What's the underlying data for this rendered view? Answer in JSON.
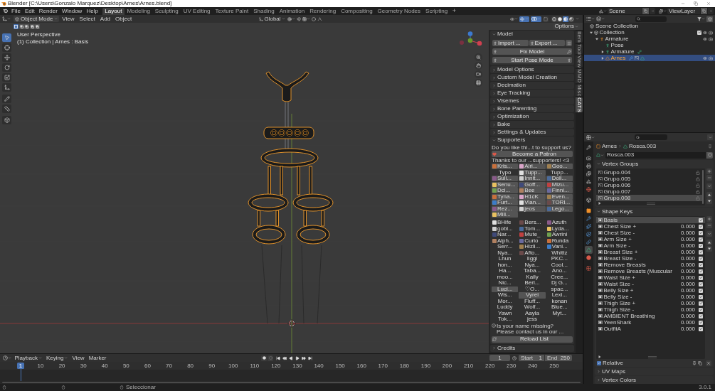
{
  "window": {
    "title": "Blender [C:\\Users\\Gonzalo Marquez\\Desktop\\Arnes\\Arnes.blend]"
  },
  "menu": [
    "File",
    "Edit",
    "Render",
    "Window",
    "Help"
  ],
  "workspaces": [
    {
      "label": "Layout",
      "selected": true
    },
    {
      "label": "Modeling",
      "selected": false
    },
    {
      "label": "Sculpting",
      "selected": false
    },
    {
      "label": "UV Editing",
      "selected": false
    },
    {
      "label": "Texture Paint",
      "selected": false
    },
    {
      "label": "Shading",
      "selected": false
    },
    {
      "label": "Animation",
      "selected": false
    },
    {
      "label": "Rendering",
      "selected": false
    },
    {
      "label": "Compositing",
      "selected": false
    },
    {
      "label": "Geometry Nodes",
      "selected": false
    },
    {
      "label": "Scripting",
      "selected": false
    }
  ],
  "add_workspace": "+",
  "scene_selector": {
    "scene": "Scene",
    "view_layer": "ViewLayer"
  },
  "viewport": {
    "mode": "Object Mode",
    "menus": [
      "View",
      "Select",
      "Add",
      "Object"
    ],
    "orientation": "Global",
    "toggles": [
      {
        "kind": "gizmos",
        "on": true
      },
      {
        "kind": "overlays",
        "on": true
      },
      {
        "kind": "xray",
        "on": false
      }
    ],
    "shading": [
      {
        "kind": "wireframe",
        "selected": false
      },
      {
        "kind": "solid",
        "selected": false
      },
      {
        "kind": "material",
        "selected": true
      },
      {
        "kind": "rendered",
        "selected": false
      }
    ],
    "select_modes": [
      {
        "selected": true
      },
      {
        "selected": false
      },
      {
        "selected": false
      },
      {
        "selected": false
      },
      {
        "selected": false
      }
    ],
    "options": "Options",
    "view_info": [
      "User Perspective",
      "(1) Collection | Arnes : Basis"
    ],
    "tools": [
      {
        "kind": "select",
        "selected": true
      },
      {
        "kind": "cursor",
        "selected": false
      },
      {
        "kind": "move",
        "selected": false
      },
      {
        "kind": "rotate",
        "selected": false
      },
      {
        "kind": "scale",
        "selected": false
      },
      {
        "kind": "transform",
        "selected": false
      },
      {
        "kind": "annotate",
        "selected": false
      },
      {
        "kind": "measure",
        "selected": false
      },
      {
        "kind": "add-cube",
        "selected": false
      }
    ]
  },
  "sidebar_tabs": [
    {
      "label": "Item",
      "selected": false
    },
    {
      "label": "Tool",
      "selected": false
    },
    {
      "label": "View",
      "selected": false
    },
    {
      "label": "MMD",
      "selected": false
    },
    {
      "label": "Misc",
      "selected": false
    },
    {
      "label": "CATS",
      "selected": true
    }
  ],
  "cats": {
    "model": {
      "title": "Model",
      "expanded": true,
      "import": "Import ...",
      "export": "Export ...",
      "fix": "Fix Model",
      "pose": "Start Pose Mode"
    },
    "sections": [
      {
        "title": "Model Options",
        "expanded": false
      },
      {
        "title": "Custom Model Creation",
        "expanded": false
      },
      {
        "title": "Decimation",
        "expanded": false
      },
      {
        "title": "Eye Tracking",
        "expanded": false
      },
      {
        "title": "Visemes",
        "expanded": false
      },
      {
        "title": "Bone Parenting",
        "expanded": false
      },
      {
        "title": "Optimization",
        "expanded": false
      },
      {
        "title": "Bake",
        "expanded": false
      },
      {
        "title": "Settings & Updates",
        "expanded": false
      }
    ],
    "supporters": {
      "title": "Supporters",
      "expanded": true,
      "question": "Do you like thi...t to support us?",
      "patron": "Become a Patron",
      "thanks": "Thanks to our ...supporters! <3",
      "featured": [
        {
          "name": "Kris...",
          "kind": "tile",
          "avatar": true
        },
        {
          "name": "Airi...",
          "kind": "tile",
          "avatar": true
        },
        {
          "name": "Goo...",
          "kind": "tile",
          "avatar": true
        },
        {
          "name": "Typo",
          "kind": "plain",
          "avatar": false
        },
        {
          "name": "Tupp...",
          "kind": "tile",
          "avatar": true
        },
        {
          "name": "Tupp...",
          "kind": "plain",
          "avatar": false
        },
        {
          "name": "Suli...",
          "kind": "tile",
          "avatar": true
        },
        {
          "name": "Innit...",
          "kind": "tile",
          "avatar": true
        },
        {
          "name": "Doli...",
          "kind": "tile",
          "avatar": true
        },
        {
          "name": "Senu...",
          "kind": "tile",
          "avatar": true
        },
        {
          "name": "Goff...",
          "kind": "tile",
          "avatar": true
        },
        {
          "name": "Mizu...",
          "kind": "tile",
          "avatar": true
        },
        {
          "name": "Dci...",
          "kind": "tile",
          "avatar": true
        },
        {
          "name": "Bee",
          "kind": "tile",
          "avatar": true
        },
        {
          "name": "Finni...",
          "kind": "tile",
          "avatar": true
        },
        {
          "name": "Tyna...",
          "kind": "tile",
          "avatar": true
        },
        {
          "name": "H1cK",
          "kind": "tile",
          "avatar": true
        },
        {
          "name": "Even...",
          "kind": "tile",
          "avatar": true
        },
        {
          "name": "Furt...",
          "kind": "tile",
          "avatar": true
        },
        {
          "name": "Vian...",
          "kind": "tile",
          "avatar": true
        },
        {
          "name": "TORI...",
          "kind": "tile",
          "avatar": true
        },
        {
          "name": "Rez...",
          "kind": "tile",
          "avatar": true
        },
        {
          "name": "jeos",
          "kind": "tile",
          "avatar": true
        },
        {
          "name": "Lego...",
          "kind": "tile",
          "avatar": true
        },
        {
          "name": "Mili...",
          "kind": "tile",
          "avatar": true
        }
      ],
      "others": [
        {
          "name": "BHife",
          "kind": "plain",
          "avatar": true
        },
        {
          "name": "Bers...",
          "kind": "plain",
          "avatar": true
        },
        {
          "name": "Azuth",
          "kind": "plain",
          "avatar": true
        },
        {
          "name": "gobl...",
          "kind": "plain",
          "avatar": true
        },
        {
          "name": "Tom...",
          "kind": "plain",
          "avatar": true
        },
        {
          "name": "Lyda...",
          "kind": "plain",
          "avatar": true
        },
        {
          "name": "Nar...",
          "kind": "plain",
          "avatar": true
        },
        {
          "name": "Mute_",
          "kind": "plain",
          "avatar": true
        },
        {
          "name": "Awrini",
          "kind": "plain",
          "avatar": true
        },
        {
          "name": "Alph...",
          "kind": "plain",
          "avatar": true
        },
        {
          "name": "Curio",
          "kind": "plain",
          "avatar": true
        },
        {
          "name": "Runda",
          "kind": "plain",
          "avatar": true
        },
        {
          "name": "Serr...",
          "kind": "plain",
          "avatar": false
        },
        {
          "name": "Hizli...",
          "kind": "plain",
          "avatar": true
        },
        {
          "name": "Vani...",
          "kind": "plain",
          "avatar": true
        },
        {
          "name": "Nya...",
          "kind": "plain",
          "avatar": false
        },
        {
          "name": "Afto...",
          "kind": "plain",
          "avatar": true
        },
        {
          "name": "Whittz",
          "kind": "plain",
          "avatar": false
        },
        {
          "name": "Lhun",
          "kind": "plain",
          "avatar": false
        },
        {
          "name": "Iiggi",
          "kind": "plain",
          "avatar": false
        },
        {
          "name": "PKC...",
          "kind": "plain",
          "avatar": false
        },
        {
          "name": "hon...",
          "kind": "plain",
          "avatar": false
        },
        {
          "name": "Nya...",
          "kind": "plain",
          "avatar": false
        },
        {
          "name": "Cool...",
          "kind": "plain",
          "avatar": false
        },
        {
          "name": "Ha...",
          "kind": "plain",
          "avatar": false
        },
        {
          "name": "Taba...",
          "kind": "plain",
          "avatar": false
        },
        {
          "name": "Ano...",
          "kind": "plain",
          "avatar": false
        },
        {
          "name": "moo...",
          "kind": "plain",
          "avatar": false
        },
        {
          "name": "Kaily",
          "kind": "plain",
          "avatar": false
        },
        {
          "name": "Cree...",
          "kind": "plain",
          "avatar": false
        },
        {
          "name": "Nic...",
          "kind": "plain",
          "avatar": false
        },
        {
          "name": "Berl...",
          "kind": "plain",
          "avatar": false
        },
        {
          "name": "Dj G...",
          "kind": "plain",
          "avatar": false
        },
        {
          "name": "Luci...",
          "kind": "tile",
          "avatar": false
        },
        {
          "name": "♡O...",
          "kind": "plain",
          "avatar": false
        },
        {
          "name": "spac...",
          "kind": "plain",
          "avatar": false
        },
        {
          "name": "Wis...",
          "kind": "plain",
          "avatar": false
        },
        {
          "name": "Vyrei",
          "kind": "tile",
          "avatar": false
        },
        {
          "name": "Lexi...",
          "kind": "plain",
          "avatar": false
        },
        {
          "name": "Mor...",
          "kind": "plain",
          "avatar": false
        },
        {
          "name": "Fluff...",
          "kind": "plain",
          "avatar": false
        },
        {
          "name": "konan",
          "kind": "plain",
          "avatar": false
        },
        {
          "name": "Luddy",
          "kind": "plain",
          "avatar": false
        },
        {
          "name": "Wolf...",
          "kind": "plain",
          "avatar": false
        },
        {
          "name": "Blue...",
          "kind": "plain",
          "avatar": false
        },
        {
          "name": "Yawn",
          "kind": "plain",
          "avatar": false
        },
        {
          "name": "Aayla",
          "kind": "plain",
          "avatar": false
        },
        {
          "name": "Myt...",
          "kind": "plain",
          "avatar": false
        },
        {
          "name": "Tok...",
          "kind": "plain",
          "avatar": false
        },
        {
          "name": "jess",
          "kind": "plain",
          "avatar": false
        }
      ],
      "missing": [
        "Is your name missing?",
        "Please contact us in our ..."
      ],
      "reload": "Reload List"
    },
    "credits": {
      "title": "Credits",
      "expanded": false
    }
  },
  "outliner": {
    "tree": [
      {
        "label": "Scene Collection",
        "kind": "scene-collection",
        "selected": false,
        "children": [
          {
            "label": "Collection",
            "kind": "collection",
            "expanded": true,
            "selected": false,
            "checked": true,
            "visible": true,
            "renderable": true,
            "children": [
              {
                "label": "Armature",
                "kind": "armature",
                "expanded": true,
                "selected": false,
                "visible": true,
                "renderable": true,
                "children": [
                  {
                    "label": "Pose",
                    "kind": "pose",
                    "selected": false
                  },
                  {
                    "label": "Armature",
                    "kind": "armature-data",
                    "expanded": false,
                    "selected": false
                  },
                  {
                    "label": "Arnes",
                    "kind": "mesh",
                    "expanded": false,
                    "selected": true,
                    "visible": true,
                    "renderable": true
                  }
                ]
              }
            ]
          }
        ]
      }
    ]
  },
  "properties": {
    "tabs": [
      {
        "kind": "tool",
        "selected": false
      },
      {
        "kind": "render",
        "selected": false
      },
      {
        "kind": "output",
        "selected": false
      },
      {
        "kind": "view-layer",
        "selected": false
      },
      {
        "kind": "scene",
        "selected": false
      },
      {
        "kind": "world",
        "selected": false
      },
      {
        "kind": "collection",
        "selected": false
      },
      {
        "kind": "object",
        "selected": false
      },
      {
        "kind": "modifiers",
        "selected": false
      },
      {
        "kind": "particles",
        "selected": false
      },
      {
        "kind": "physics",
        "selected": false
      },
      {
        "kind": "constraints",
        "selected": false
      },
      {
        "kind": "data",
        "selected": true
      },
      {
        "kind": "material",
        "selected": false
      },
      {
        "kind": "texture",
        "selected": false
      }
    ],
    "breadcrumb": {
      "object": "Arnes",
      "data": "Rosca.003"
    },
    "datablock": "Rosca.003",
    "vertex_groups": {
      "title": "Vertex Groups",
      "expanded": true,
      "items": [
        {
          "name": "Grupo.004",
          "selected": false,
          "locked": false
        },
        {
          "name": "Grupo.005",
          "selected": false,
          "locked": false
        },
        {
          "name": "Grupo.006",
          "selected": false,
          "locked": false
        },
        {
          "name": "Grupo.007",
          "selected": false,
          "locked": false
        },
        {
          "name": "Grupo.008",
          "selected": true,
          "locked": false
        }
      ]
    },
    "shape_keys": {
      "title": "Shape Keys",
      "expanded": true,
      "items": [
        {
          "name": "Basis",
          "selected": true,
          "checked": true
        },
        {
          "name": "Chest Size +",
          "value": "0.000",
          "selected": false,
          "checked": true
        },
        {
          "name": "Chest Size -",
          "value": "0.000",
          "selected": false,
          "checked": true
        },
        {
          "name": "Arm Size +",
          "value": "0.000",
          "selected": false,
          "checked": true
        },
        {
          "name": "Arm Size -",
          "value": "0.000",
          "selected": false,
          "checked": true
        },
        {
          "name": "Breast Size +",
          "value": "0.000",
          "selected": false,
          "checked": true
        },
        {
          "name": "Breast Size -",
          "value": "0.000",
          "selected": false,
          "checked": true
        },
        {
          "name": "Remove Breasts",
          "value": "0.000",
          "selected": false,
          "checked": true
        },
        {
          "name": "Remove Breasts (Muscular",
          "value": "0.000",
          "selected": false,
          "checked": true
        },
        {
          "name": "Waist Size +",
          "value": "0.000",
          "selected": false,
          "checked": true
        },
        {
          "name": "Waist Size -",
          "value": "0.000",
          "selected": false,
          "checked": true
        },
        {
          "name": "Belly Size +",
          "value": "0.000",
          "selected": false,
          "checked": true
        },
        {
          "name": "Belly Size -",
          "value": "0.000",
          "selected": false,
          "checked": true
        },
        {
          "name": "Thigh Size +",
          "value": "0.000",
          "selected": false,
          "checked": true
        },
        {
          "name": "Thigh Size -",
          "value": "0.000",
          "selected": false,
          "checked": true
        },
        {
          "name": "AMBIENT Breathing",
          "value": "0.000",
          "selected": false,
          "checked": true
        },
        {
          "name": "YeenShark",
          "value": "0.000",
          "selected": false,
          "checked": true
        },
        {
          "name": "OutfitA",
          "value": "0.000",
          "selected": false,
          "checked": true
        }
      ],
      "relative": {
        "label": "Relative",
        "checked": true
      }
    },
    "more_panels": [
      {
        "title": "UV Maps",
        "expanded": false
      },
      {
        "title": "Vertex Colors",
        "expanded": false
      }
    ]
  },
  "timeline": {
    "menus": [
      {
        "label": "Playback",
        "kind": "dropdown"
      },
      {
        "label": "Keying",
        "kind": "dropdown"
      },
      {
        "label": "View",
        "kind": "menu"
      },
      {
        "label": "Marker",
        "kind": "menu"
      }
    ],
    "current_frame": "1",
    "start": {
      "label": "Start",
      "value": "1"
    },
    "end": {
      "label": "End",
      "value": "250"
    },
    "playhead": "1",
    "ruler": [
      "10",
      "20",
      "30",
      "40",
      "50",
      "60",
      "70",
      "80",
      "90",
      "100",
      "110",
      "120",
      "130",
      "140",
      "150",
      "160",
      "170",
      "180",
      "190",
      "200",
      "210",
      "220",
      "230",
      "240",
      "250"
    ]
  },
  "status_bar": {
    "hint": "Seleccionar",
    "version": "3.0.1"
  }
}
